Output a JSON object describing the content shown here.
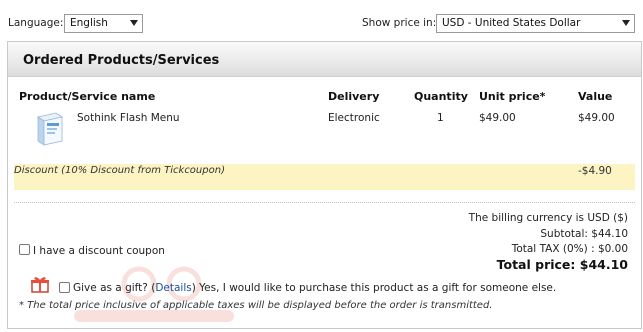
{
  "topbar": {
    "language_label": "Language:",
    "language_value": "English",
    "price_label": "Show price in:",
    "currency_value": "USD - United States Dollar"
  },
  "panel": {
    "title": "Ordered Products/Services",
    "columns": {
      "name": "Product/Service name",
      "delivery": "Delivery",
      "quantity": "Quantity",
      "unit_price": "Unit price*",
      "value": "Value"
    },
    "product": {
      "name": "Sothink Flash Menu",
      "delivery": "Electronic",
      "quantity": "1",
      "unit_price": "$49.00",
      "value": "$49.00"
    },
    "discount": {
      "label": "Discount (10% Discount from Tickcoupon)",
      "value": "-$4.90"
    },
    "summary": {
      "billing": "The billing currency is USD ($)",
      "subtotal": "Subtotal: $44.10",
      "tax": "Total TAX (0%) : $0.00",
      "total": "Total price: $44.10"
    },
    "coupon_label": "I have a discount coupon",
    "gift": {
      "prefix": "Give as a gift? (",
      "link": "Details",
      "suffix": ") Yes, I would like to purchase this product as a gift for someone else."
    },
    "note": "* The total price inclusive of applicable taxes will be displayed before the order is transmitted."
  },
  "icons": {
    "product": "product-box-icon",
    "gift": "gift-icon",
    "dropdown": "chevron-down-icon"
  },
  "colors": {
    "discount_bg": "#fdf4c4",
    "link": "#1a4fa0",
    "header_bg": "#e9e9e9"
  }
}
